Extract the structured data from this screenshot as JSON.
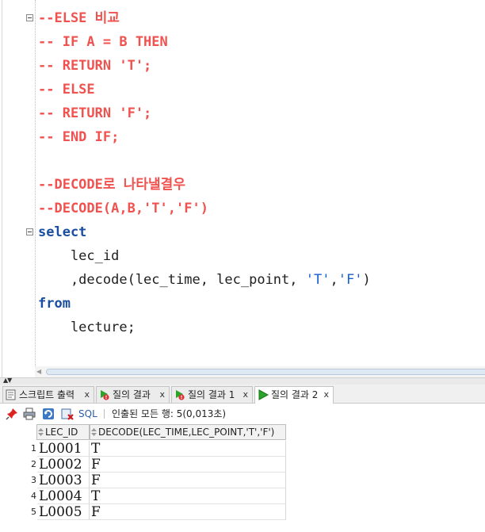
{
  "editor": {
    "lines": [
      {
        "parts": [
          {
            "cls": "c-comment",
            "text": "--ELSE 비교"
          }
        ],
        "fold": true
      },
      {
        "parts": [
          {
            "cls": "c-comment",
            "text": "-- IF A = B THEN"
          }
        ]
      },
      {
        "parts": [
          {
            "cls": "c-comment",
            "text": "-- RETURN 'T';"
          }
        ]
      },
      {
        "parts": [
          {
            "cls": "c-comment",
            "text": "-- ELSE"
          }
        ]
      },
      {
        "parts": [
          {
            "cls": "c-comment",
            "text": "-- RETURN 'F';"
          }
        ]
      },
      {
        "parts": [
          {
            "cls": "c-comment",
            "text": "-- END IF;"
          }
        ]
      },
      {
        "parts": [
          {
            "cls": "c-plain",
            "text": ""
          }
        ]
      },
      {
        "parts": [
          {
            "cls": "c-comment",
            "text": "--DECODE로 나타낼결우"
          }
        ]
      },
      {
        "parts": [
          {
            "cls": "c-comment",
            "text": "--DECODE(A,B,'T','F')"
          }
        ]
      },
      {
        "parts": [
          {
            "cls": "c-keyword",
            "text": "select"
          }
        ],
        "fold": true
      },
      {
        "parts": [
          {
            "cls": "c-plain",
            "text": "    lec_id"
          }
        ]
      },
      {
        "parts": [
          {
            "cls": "c-plain",
            "text": "    ,decode(lec_time, lec_point, "
          },
          {
            "cls": "c-str",
            "text": "'T'"
          },
          {
            "cls": "c-plain",
            "text": ","
          },
          {
            "cls": "c-str",
            "text": "'F'"
          },
          {
            "cls": "c-plain",
            "text": ")"
          }
        ]
      },
      {
        "parts": [
          {
            "cls": "c-keyword",
            "text": "from"
          }
        ]
      },
      {
        "parts": [
          {
            "cls": "c-plain",
            "text": "    lecture;"
          }
        ]
      }
    ]
  },
  "tabs": [
    {
      "label": "스크립트 출력",
      "icon": "script-output-icon",
      "close": "x",
      "active": false
    },
    {
      "label": "질의 결과",
      "icon": "query-result-icon",
      "close": "x",
      "active": false
    },
    {
      "label": "질의 결과 1",
      "icon": "query-result-icon",
      "close": "x",
      "active": false
    },
    {
      "label": "질의 결과 2",
      "icon": "run-icon",
      "close": "x",
      "active": true
    }
  ],
  "toolbar": {
    "icons": [
      "pin-icon",
      "print-icon",
      "refresh-icon",
      "export-icon"
    ],
    "sql_label": "SQL",
    "status": "인출된 모든 행: 5(0,013초)"
  },
  "grid": {
    "columns": [
      "LEC_ID",
      "DECODE(LEC_TIME,LEC_POINT,'T','F')"
    ],
    "rows": [
      {
        "num": "1",
        "cells": [
          "L0001",
          "T"
        ]
      },
      {
        "num": "2",
        "cells": [
          "L0002",
          "F"
        ]
      },
      {
        "num": "3",
        "cells": [
          "L0003",
          "F"
        ]
      },
      {
        "num": "4",
        "cells": [
          "L0004",
          "T"
        ]
      },
      {
        "num": "5",
        "cells": [
          "L0005",
          "F"
        ]
      }
    ]
  },
  "colors": {
    "comment": "#f0524f",
    "keyword": "#1a4fa0",
    "string": "#1a5fd0"
  }
}
